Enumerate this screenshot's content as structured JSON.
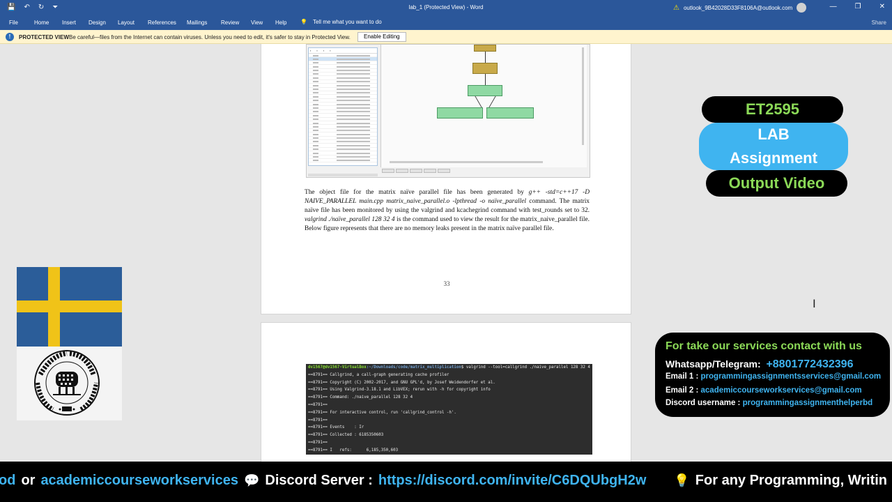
{
  "titlebar": {
    "qat": [
      "💾",
      "↶",
      "↻",
      "⏷"
    ],
    "doc_title": "lab_1 (Protected View) - Word",
    "account": "outlook_9B42028D33F8106A@outlook.com",
    "win_controls": [
      "—",
      "❐",
      "✕"
    ]
  },
  "ribbon": {
    "tabs": [
      "File",
      "Home",
      "Insert",
      "Design",
      "Layout",
      "References",
      "Mailings",
      "Review",
      "View",
      "Help"
    ],
    "tell_me": "Tell me what you want to do",
    "share": "Share"
  },
  "protected_view": {
    "title": "PROTECTED VIEW",
    "message": "Be careful—files from the Internet can contain viruses. Unless you need to edit, it's safer to stay in Protected View.",
    "enable_label": "Enable Editing"
  },
  "document": {
    "paragraph": {
      "t1": "The object file for the matrix naïve parallel file has been generated by ",
      "cmd1": "g++ -std=c++17 -D NAIVE_PARALLEL main.cpp matrix_naive_parallel.o -lpthread -o naïve_parallel",
      "t2": " command. The matrix naïve file has been monitored by using the valgrind and kcachegrind command with test_rounds set to 32. ",
      "cmd2": "valgrind ./naïve_parallel 128 32 4",
      "t3": " is the command used to view the result for the matrix_naive_parallel file. Below figure represents that there are no memory leaks present in the matrix naïve parallel file."
    },
    "page_number": "33",
    "terminal": {
      "prompt_user": "dv1567@dv1567-VirtualBox",
      "prompt_path": ":~/Downloads/code/matrix_multiplication",
      "command": "$ valgrind --tool=callgrind ./naive_parallel 128 32 4",
      "lines": [
        "==8791== Callgrind, a call-graph generating cache profiler",
        "==8791== Copyright (C) 2002-2017, and GNU GPL'd, by Josef Weidendorfer et al.",
        "==8791== Using Valgrind-3.18.1 and LibVEX; rerun with -h for copyright info",
        "==8791== Command: ./naive_parallel 128 32 4",
        "==8791==",
        "==8791== For interactive control, run 'callgrind_control -h'.",
        "==8791==",
        "==8791== Events    : Ir",
        "==8791== Collected : 6185350603",
        "==8791==",
        "==8791== I   refs:      6,185,350,603"
      ]
    }
  },
  "overlay": {
    "course_code": "ET2595",
    "lab_line1": "LAB",
    "lab_line2": "Assignment",
    "output_video": "Output Video",
    "contact": {
      "title": "For take our services contact with us",
      "whatsapp_key": "Whatsapp/Telegram:",
      "whatsapp_val": "+8801772432396",
      "email1_key": "Email 1 :",
      "email1_val": "programmingassignmentsservices@gmail.com",
      "email2_key": "Email 2 :",
      "email2_val": "academiccourseworkservices@gmail.com",
      "discord_key": "Discord username :",
      "discord_val": "programmingassignmenthelperbd"
    },
    "ticker": {
      "part1": "od",
      "part2": "or",
      "part3": "academiccourseworkservices",
      "part4": "Discord Server :",
      "part5": "https://discord.com/invite/C6DQUbgH2w",
      "part6": "For any Programming, Writin"
    }
  },
  "colors": {
    "word_blue": "#2b579a",
    "protected_bg": "#fff4ce",
    "overlay_green": "#8bd957",
    "overlay_blue": "#3fb4f0"
  }
}
